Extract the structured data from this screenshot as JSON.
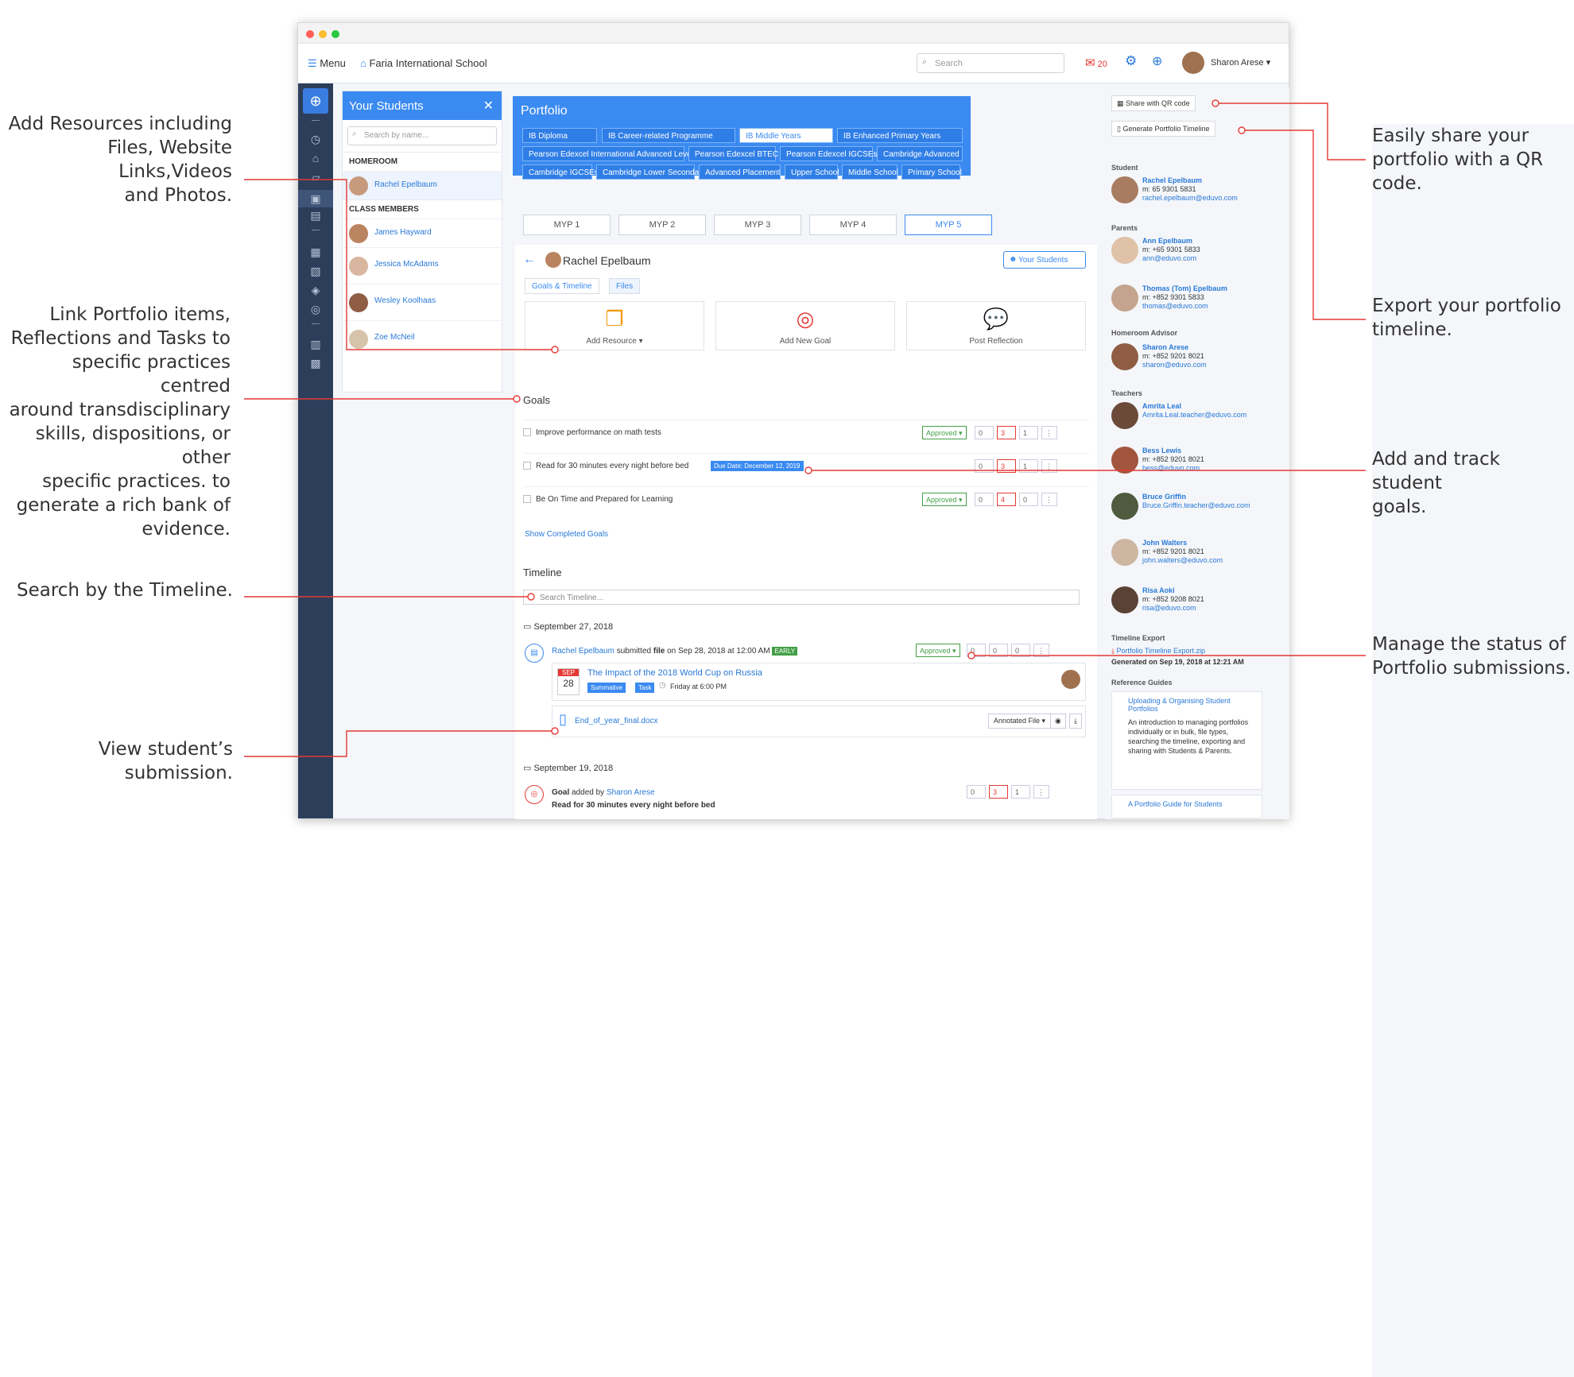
{
  "callouts": {
    "add_resources": [
      "Add Resources including",
      "Files, Website Links,Videos",
      "and Photos."
    ],
    "link_portfolio": [
      "Link Portfolio items,",
      "Reflections and Tasks to",
      "specific practices centred",
      "around transdisciplinary",
      "skills, dispositions, or other",
      "specific practices. to",
      "generate a rich bank of",
      "evidence."
    ],
    "search_timeline": [
      "Search by the Timeline."
    ],
    "view_submission": [
      "View student’s submission."
    ],
    "share_qr": [
      "Easily share your",
      "portfolio with a QR",
      "code."
    ],
    "export_timeline": [
      "Export your portfolio",
      "timeline."
    ],
    "track_goals": [
      "Add and track student",
      "goals."
    ],
    "manage_status": [
      "Manage the status of",
      "Portfolio submissions."
    ]
  },
  "topbar": {
    "menu_label": "Menu",
    "school_name": "Faria International School",
    "search_placeholder": "Search",
    "mail_count": "20",
    "user_name": "Sharon Arese"
  },
  "students_panel": {
    "title": "Your Students",
    "search_placeholder": "Search by name...",
    "homeroom_label": "HOMEROOM",
    "homeroom_student": "Rachel Epelbaum",
    "class_members_label": "CLASS MEMBERS",
    "class_members": [
      "James Hayward",
      "Jessica McAdams",
      "Wesley Koolhaas",
      "Zoe McNeil"
    ]
  },
  "portfolio": {
    "title": "Portfolio",
    "programmes": [
      "IB Diploma",
      "IB Career-related Programme",
      "IB Middle Years",
      "IB Enhanced Primary Years",
      "Pearson Edexcel International Advanced Levels",
      "Pearson Edexcel BTEC",
      "Pearson Edexcel IGCSEs",
      "Cambridge Advanced",
      "Cambridge IGCSEs",
      "Cambridge Lower Secondary",
      "Advanced Placement",
      "Upper School",
      "Middle School",
      "Primary School"
    ],
    "active_programme": "IB Middle Years",
    "myp_tabs": [
      "MYP 1",
      "MYP 2",
      "MYP 3",
      "MYP 4",
      "MYP 5"
    ],
    "active_myp": "MYP 5"
  },
  "student_view": {
    "name": "Rachel Epelbaum",
    "your_students_button": "Your Students",
    "tabs": [
      "Goals & Timeline",
      "Files"
    ],
    "actions": [
      "Add Resource",
      "Add New Goal",
      "Post Reflection"
    ]
  },
  "goals": {
    "heading": "Goals",
    "items": [
      {
        "text": "Improve performance on math tests",
        "status": "Approved",
        "shares": "0",
        "likes": "3",
        "comments": "1"
      },
      {
        "text": "Read for 30 minutes every night before bed",
        "due": "Due Date: December 12, 2019",
        "shares": "0",
        "likes": "3",
        "comments": "1"
      },
      {
        "text": "Be On Time and Prepared for Learning",
        "status": "Approved",
        "shares": "0",
        "likes": "4",
        "comments": "0"
      }
    ],
    "show_completed": "Show Completed Goals"
  },
  "timeline": {
    "heading": "Timeline",
    "search_placeholder": "Search Timeline...",
    "date1": "September 27, 2018",
    "entry1": {
      "student": "Rachel Epelbaum",
      "action": "submitted",
      "type": "file",
      "when": "on Sep 28, 2018 at 12:00 AM",
      "badge": "EARLY",
      "status": "Approved",
      "shares": "0",
      "likes": "0",
      "comments": "0"
    },
    "task": {
      "month": "SEP",
      "day": "28",
      "title": "The Impact of the 2018 World Cup on Russia",
      "tags": [
        "Summative",
        "Task"
      ],
      "due": "Friday at 6:00 PM"
    },
    "file": {
      "name": "End_of_year_final.docx",
      "type_button": "Annotated File"
    },
    "date2": "September 19, 2018",
    "entry2": {
      "kind": "Goal",
      "action": "added by",
      "author": "Sharon Arese",
      "text": "Read for 30 minutes every night before bed",
      "shares": "0",
      "likes": "3",
      "comments": "1"
    }
  },
  "sidebar_right": {
    "share_qr": "Share with QR code",
    "generate_export": "Generate Portfolio Timeline",
    "student_label": "Student",
    "student": {
      "name": "Rachel Epelbaum",
      "phone": "m: 65 9301 5831",
      "email": "rachel.epelbaum@eduvo.com"
    },
    "parents_label": "Parents",
    "parents": [
      {
        "name": "Ann Epelbaum",
        "phone": "m: +65 9301 5833",
        "email": "ann@eduvo.com"
      },
      {
        "name": "Thomas (Tom) Epelbaum",
        "phone": "m: +852 9301 5833",
        "email": "thomas@eduvo.com"
      }
    ],
    "advisor_label": "Homeroom Advisor",
    "advisor": {
      "name": "Sharon Arese",
      "phone": "m: +852 9201 8021",
      "email": "sharon@eduvo.com"
    },
    "teachers_label": "Teachers",
    "teachers": [
      {
        "name": "Amrita Leal",
        "phone": "",
        "email": "Amrita.Leal.teacher@eduvo.com"
      },
      {
        "name": "Bess Lewis",
        "phone": "m: +852 9201 8021",
        "email": "bess@eduvo.com"
      },
      {
        "name": "Bruce Griffin",
        "phone": "",
        "email": "Bruce.Griffin.teacher@eduvo.com"
      },
      {
        "name": "John Walters",
        "phone": "m: +852 9201 8021",
        "email": "john.walters@eduvo.com"
      },
      {
        "name": "Risa Aoki",
        "phone": "m: +852 9208 8021",
        "email": "risa@eduvo.com"
      }
    ],
    "export_label": "Timeline Export",
    "export_file": "Portfolio Timeline Export.zip",
    "export_generated": "Generated on Sep 19, 2018 at 12:21 AM",
    "guides_label": "Reference Guides",
    "guide1_title": "Uploading & Organising Student Portfolios",
    "guide1_desc": "An introduction to managing portfolios individually or in bulk, file types, searching the timeline, exporting and sharing with Students & Parents.",
    "guide2_title": "A Portfolio Guide for Students"
  },
  "colors": {
    "accent": "#3a8af1",
    "nav": "#2c3e5a",
    "callout_line": "#e53935",
    "approved": "#43a047"
  }
}
